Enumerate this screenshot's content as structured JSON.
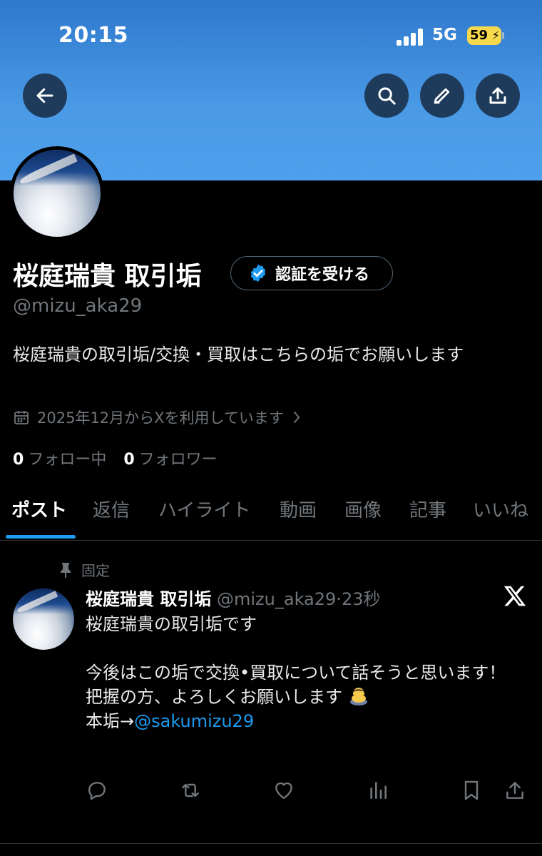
{
  "status_bar": {
    "time": "20:15",
    "network": "5G",
    "battery": "59"
  },
  "header": {
    "back_icon": "arrow-left-icon",
    "search_icon": "search-icon",
    "edit_icon": "pencil-icon",
    "share_icon": "share-upload-icon"
  },
  "colors": {
    "banner": "#4a9ae6",
    "accent": "#1d9bf0",
    "muted": "#71767b",
    "battery": "#f6d94c"
  },
  "profile": {
    "name": "桜庭瑞貴 取引垢",
    "verify_label": "認証を受ける",
    "handle": "@mizu_aka29",
    "bio": "桜庭瑞貴の取引垢/交換・買取はこちらの垢でお願いします",
    "joined": "2025年12月からXを利用しています",
    "following_count": "0",
    "following_label": "フォロー中",
    "followers_count": "0",
    "followers_label": "フォロワー"
  },
  "tabs": [
    "ポスト",
    "返信",
    "ハイライト",
    "動画",
    "画像",
    "記事",
    "いいね"
  ],
  "active_tab": "ポスト",
  "pinned_post": {
    "pinned_label": "固定",
    "author_name": "桜庭瑞貴 取引垢",
    "author_handle": "@mizu_aka29",
    "separator": "·",
    "time": "23秒",
    "line1": "桜庭瑞貴の取引垢です",
    "line2": "今後はこの垢で交換•買取について話そうと思います！",
    "line3": "把握の方、よろしくお願いします",
    "line4_prefix": "本垢→",
    "mention": "@sakumizu29"
  },
  "post_actions": [
    "reply-icon",
    "repost-icon",
    "like-icon",
    "views-icon",
    "bookmark-icon",
    "share-icon"
  ]
}
